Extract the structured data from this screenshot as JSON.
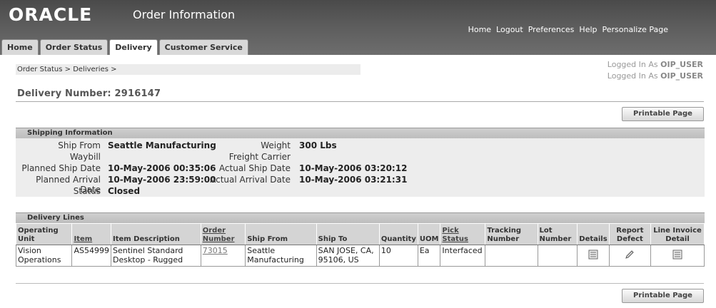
{
  "header": {
    "logo": "ORACLE",
    "app_title": "Order Information",
    "global_links": [
      "Home",
      "Logout",
      "Preferences",
      "Help",
      "Personalize Page"
    ]
  },
  "tabs": [
    {
      "label": "Home",
      "active": false
    },
    {
      "label": "Order Status",
      "active": false
    },
    {
      "label": "Delivery",
      "active": true
    },
    {
      "label": "Customer Service",
      "active": false
    }
  ],
  "breadcrumb": "Order Status  >  Deliveries  >",
  "logged_in": {
    "prefix": "Logged In As",
    "user": "OIP_USER"
  },
  "page_title": "Delivery Number: 2916147",
  "buttons": {
    "printable": "Printable Page"
  },
  "shipping": {
    "heading": "Shipping Information",
    "ship_from_label": "Ship From",
    "ship_from": "Seattle Manufacturing",
    "waybill_label": "Waybill",
    "waybill": "",
    "planned_ship_label": "Planned Ship Date",
    "planned_ship": "10-May-2006 00:35:06",
    "planned_arrival_label": "Planned Arrival Date",
    "planned_arrival": "10-May-2006 23:59:00",
    "status_label": "Status",
    "status": "Closed",
    "weight_label": "Weight",
    "weight": "300 Lbs",
    "freight_label": "Freight Carrier",
    "freight": "",
    "actual_ship_label": "Actual Ship Date",
    "actual_ship": "10-May-2006 03:20:12",
    "actual_arrival_label": "Actual Arrival Date",
    "actual_arrival": "10-May-2006 03:21:31"
  },
  "lines": {
    "heading": "Delivery Lines",
    "columns": {
      "operating_unit": "Operating Unit",
      "item": "Item",
      "item_description": "Item Description",
      "order_number": "Order Number",
      "ship_from": "Ship From",
      "ship_to": "Ship To",
      "quantity": "Quantity",
      "uom": "UOM",
      "pick_status": "Pick Status",
      "tracking_number": "Tracking Number",
      "lot_number": "Lot Number",
      "details": "Details",
      "report_defect": "Report Defect",
      "line_invoice_detail": "Line Invoice Detail"
    },
    "row": {
      "operating_unit": "Vision Operations",
      "item": "AS54999",
      "item_description": "Sentinel Standard Desktop - Rugged",
      "order_number": "73015",
      "ship_from": "Seattle Manufacturing",
      "ship_to": "SAN JOSE, CA, 95106, US",
      "quantity": "10",
      "uom": "Ea",
      "pick_status": "Interfaced",
      "tracking_number": "",
      "lot_number": ""
    }
  },
  "icons": {
    "details": "details-icon",
    "report_defect": "pencil-icon",
    "invoice": "invoice-icon"
  }
}
